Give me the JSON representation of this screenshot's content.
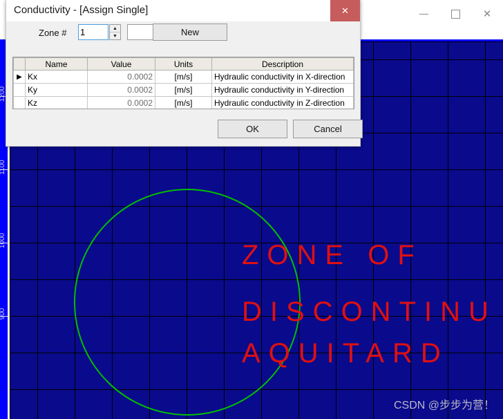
{
  "app_window": {
    "minimize_label": "—",
    "maximize_label": "□",
    "close_label": "✕"
  },
  "canvas": {
    "background_color": "#0a0a8c",
    "grid_color": "#000000",
    "ruler_color": "#0000ff",
    "circle_color": "#00c000",
    "annotation_color": "#e01010",
    "ruler_labels": [
      "1200",
      "1100",
      "1000",
      "900"
    ],
    "annotations": [
      "ZONE OF",
      "DISCONTINU",
      "AQUITARD"
    ],
    "watermark": "CSDN @步步为营！"
  },
  "dialog": {
    "title": "Conductivity - [Assign Single]",
    "close_label": "✕",
    "close_color": "#c75c5c",
    "zone_label": "Zone #",
    "zone_value": "1",
    "zone_extra_value": "",
    "spinner_up": "▲",
    "spinner_down": "▼",
    "new_label": "New",
    "ok_label": "OK",
    "cancel_label": "Cancel",
    "table": {
      "columns": [
        "",
        "Name",
        "Value",
        "Units",
        "Description"
      ],
      "rows": [
        {
          "selected": "▶",
          "name": "Kx",
          "value": "0.0002",
          "units": "[m/s]",
          "description": "Hydraulic conductivity in X-direction"
        },
        {
          "selected": "",
          "name": "Ky",
          "value": "0.0002",
          "units": "[m/s]",
          "description": "Hydraulic conductivity in Y-direction"
        },
        {
          "selected": "",
          "name": "Kz",
          "value": "0.0002",
          "units": "[m/s]",
          "description": "Hydraulic conductivity in Z-direction"
        }
      ]
    }
  }
}
